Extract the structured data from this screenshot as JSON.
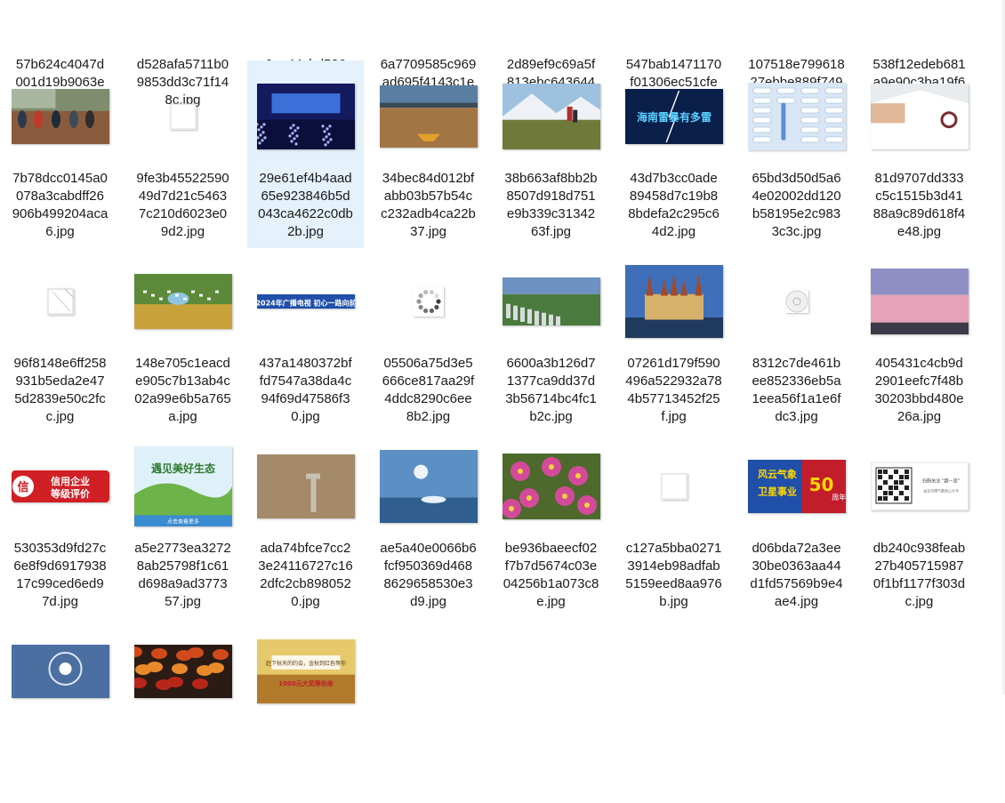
{
  "files": [
    {
      "lines": [
        "57b624c4047d",
        "001d19b9063e",
        "d61.jpg"
      ],
      "thumb": "none"
    },
    {
      "lines": [
        "d528afa5711b0",
        "9853dd3c71f14",
        "8c.jpg"
      ],
      "thumb": "none"
    },
    {
      "lines": [
        "e6ae44cbd526a",
        "772602b9d4d0",
        "44.jpg"
      ],
      "thumb": "none"
    },
    {
      "lines": [
        "6a7709585c969",
        "ad695f4143c1e",
        "4d.jpg"
      ],
      "thumb": "none"
    },
    {
      "lines": [
        "2d89ef9c69a5f",
        "813ebc643644",
        "d3.jpg"
      ],
      "thumb": "none"
    },
    {
      "lines": [
        "547bab1471170",
        "f01306ec51cfe",
        "d.jpg"
      ],
      "thumb": "none"
    },
    {
      "lines": [
        "107518e799618",
        "27ebbe889f749",
        "b8.jpg"
      ],
      "thumb": "none"
    },
    {
      "lines": [
        "538f12edeb681",
        "a9e90c3ba19f6",
        "e.jpg"
      ],
      "thumb": "none"
    },
    {
      "lines": [
        "7b78dcc0145a0",
        "078a3cabdff26",
        "906b499204aca",
        "6.jpg"
      ],
      "thumb": "flood-photo"
    },
    {
      "lines": [
        "9fe3b45522590",
        "49d7d21c5463",
        "7c210d6023e0",
        "9d2.jpg"
      ],
      "thumb": "blank-file"
    },
    {
      "lines": [
        "29e61ef4b4aad",
        "65e923846b5d",
        "043ca4622c0db",
        "2b.jpg"
      ],
      "thumb": "conference-stage",
      "selected": true
    },
    {
      "lines": [
        "34bec84d012bf",
        "abb03b57b54c",
        "c232adb4ca22b",
        "37.jpg"
      ],
      "thumb": "river-boat"
    },
    {
      "lines": [
        "38b663af8bb2b",
        "8507d918d751",
        "e9b339c31342",
        "63f.jpg"
      ],
      "thumb": "mountain-hikers"
    },
    {
      "lines": [
        "43d7b3cc0ade",
        "89458d7c19b8",
        "8bdefa2c295c6",
        "4d2.jpg"
      ],
      "thumb": "storm-poster",
      "text": "海南雷暴有多雷"
    },
    {
      "lines": [
        "65bd3d50d5a6",
        "4e02002dd120",
        "b58195e2c983",
        "3c3c.jpg"
      ],
      "thumb": "weather-chart"
    },
    {
      "lines": [
        "81d9707dd333",
        "c5c1515b3d41",
        "88a9c89d618f4",
        "e48.jpg"
      ],
      "thumb": "doctor-stethoscope"
    },
    {
      "lines": [
        "96f8148e6ff258",
        "931b5eda2e47",
        "5d2839e50c2fc",
        "c.jpg"
      ],
      "thumb": "blank-file-folded"
    },
    {
      "lines": [
        "148e705c1eacd",
        "e905c7b13ab4c",
        "02a99e6b5a765",
        "a.jpg"
      ],
      "thumb": "aerial-village"
    },
    {
      "lines": [
        "437a1480372bf",
        "fd7547a38da4c",
        "94f69d47586f3",
        "0.jpg"
      ],
      "thumb": "blue-banner",
      "text": "2024年广播电视 初心一路向前"
    },
    {
      "lines": [
        "05506a75d3e5",
        "666ce817aa29f",
        "4ddc8290c6ee",
        "8b2.jpg"
      ],
      "thumb": "loading-spinner"
    },
    {
      "lines": [
        "6600a3b126d7",
        "1377ca9dd37d",
        "3b56714bc4fc1",
        "b2c.jpg"
      ],
      "thumb": "aerial-field"
    },
    {
      "lines": [
        "07261d179f590",
        "496a522932a78",
        "4b57713452f25",
        "f.jpg"
      ],
      "thumb": "castle"
    },
    {
      "lines": [
        "8312c7de461b",
        "ee852336eb5a",
        "1eea56f1a1e6f",
        "dc3.jpg"
      ],
      "thumb": "placeholder-icon"
    },
    {
      "lines": [
        "405431c4cb9d",
        "2901eefc7f48b",
        "30203bbd480e",
        "26a.jpg"
      ],
      "thumb": "pink-sky"
    },
    {
      "lines": [
        "530353d9fd27c",
        "6e8f9d6917938",
        "17c99ced6ed9",
        "7d.jpg"
      ],
      "thumb": "credit-badge",
      "text": "信用企业 等级评价",
      "badge": "信"
    },
    {
      "lines": [
        "a5e2773ea3272",
        "8ab25798f1c61",
        "d698a9ad3773",
        "57.jpg"
      ],
      "thumb": "eco-poster",
      "text": "遇见美好生态",
      "sub": "点击查看更多"
    },
    {
      "lines": [
        "ada74bfce7cc2",
        "3e24116727c16",
        "2dfc2cb898052",
        "0.jpg"
      ],
      "thumb": "hazy-tower"
    },
    {
      "lines": [
        "ae5a40e0066b6",
        "fcf950369d468",
        "8629658530e3",
        "d9.jpg"
      ],
      "thumb": "ice-sea"
    },
    {
      "lines": [
        "be936baeecf02",
        "f7b7d5674c03e",
        "04256b1a073c8",
        "e.jpg"
      ],
      "thumb": "flowers"
    },
    {
      "lines": [
        "c127a5bba0271",
        "3914eb98adfab",
        "5159eed8aa976",
        "b.jpg"
      ],
      "thumb": "blank-file"
    },
    {
      "lines": [
        "d06bda72a3ee",
        "30be0363aa44",
        "d1fd57569b9e4",
        "ae4.jpg"
      ],
      "thumb": "anniversary-poster",
      "text": "风云气象 卫星事业",
      "num": "50",
      "unit": "周年"
    },
    {
      "lines": [
        "db240c938feab",
        "27b405715987",
        "0f1bf1177f303d",
        "c.jpg"
      ],
      "thumb": "qr-card",
      "text": "扫码关注 “超一流”",
      "sub": "关注中国气象局公众号"
    },
    {
      "lines": [],
      "thumb": "halo-sky"
    },
    {
      "lines": [],
      "thumb": "autumn-leaves"
    },
    {
      "lines": [],
      "thumb": "fields-banner",
      "text": "赶下秋天的约会，金秋到红色等你",
      "sub": "1000元大奖等你来"
    }
  ]
}
